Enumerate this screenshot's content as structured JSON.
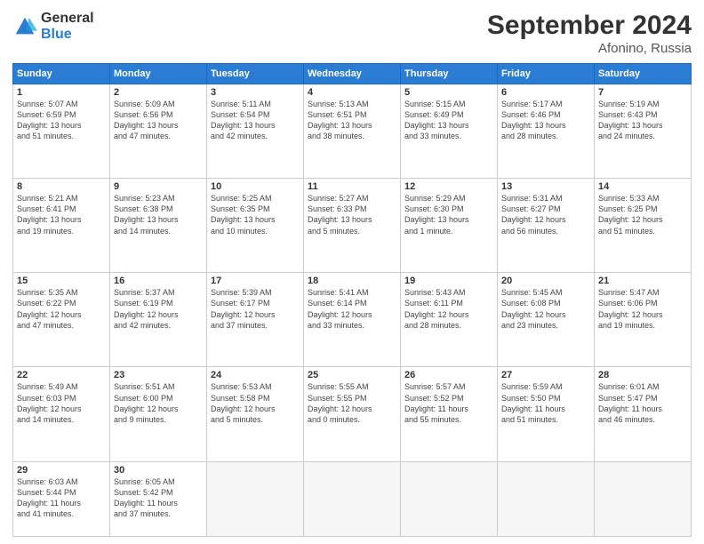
{
  "header": {
    "logo_general": "General",
    "logo_blue": "Blue",
    "title": "September 2024",
    "location": "Afonino, Russia"
  },
  "weekdays": [
    "Sunday",
    "Monday",
    "Tuesday",
    "Wednesday",
    "Thursday",
    "Friday",
    "Saturday"
  ],
  "weeks": [
    [
      {
        "day": "1",
        "info": "Sunrise: 5:07 AM\nSunset: 6:59 PM\nDaylight: 13 hours\nand 51 minutes."
      },
      {
        "day": "2",
        "info": "Sunrise: 5:09 AM\nSunset: 6:56 PM\nDaylight: 13 hours\nand 47 minutes."
      },
      {
        "day": "3",
        "info": "Sunrise: 5:11 AM\nSunset: 6:54 PM\nDaylight: 13 hours\nand 42 minutes."
      },
      {
        "day": "4",
        "info": "Sunrise: 5:13 AM\nSunset: 6:51 PM\nDaylight: 13 hours\nand 38 minutes."
      },
      {
        "day": "5",
        "info": "Sunrise: 5:15 AM\nSunset: 6:49 PM\nDaylight: 13 hours\nand 33 minutes."
      },
      {
        "day": "6",
        "info": "Sunrise: 5:17 AM\nSunset: 6:46 PM\nDaylight: 13 hours\nand 28 minutes."
      },
      {
        "day": "7",
        "info": "Sunrise: 5:19 AM\nSunset: 6:43 PM\nDaylight: 13 hours\nand 24 minutes."
      }
    ],
    [
      {
        "day": "8",
        "info": "Sunrise: 5:21 AM\nSunset: 6:41 PM\nDaylight: 13 hours\nand 19 minutes."
      },
      {
        "day": "9",
        "info": "Sunrise: 5:23 AM\nSunset: 6:38 PM\nDaylight: 13 hours\nand 14 minutes."
      },
      {
        "day": "10",
        "info": "Sunrise: 5:25 AM\nSunset: 6:35 PM\nDaylight: 13 hours\nand 10 minutes."
      },
      {
        "day": "11",
        "info": "Sunrise: 5:27 AM\nSunset: 6:33 PM\nDaylight: 13 hours\nand 5 minutes."
      },
      {
        "day": "12",
        "info": "Sunrise: 5:29 AM\nSunset: 6:30 PM\nDaylight: 13 hours\nand 1 minute."
      },
      {
        "day": "13",
        "info": "Sunrise: 5:31 AM\nSunset: 6:27 PM\nDaylight: 12 hours\nand 56 minutes."
      },
      {
        "day": "14",
        "info": "Sunrise: 5:33 AM\nSunset: 6:25 PM\nDaylight: 12 hours\nand 51 minutes."
      }
    ],
    [
      {
        "day": "15",
        "info": "Sunrise: 5:35 AM\nSunset: 6:22 PM\nDaylight: 12 hours\nand 47 minutes."
      },
      {
        "day": "16",
        "info": "Sunrise: 5:37 AM\nSunset: 6:19 PM\nDaylight: 12 hours\nand 42 minutes."
      },
      {
        "day": "17",
        "info": "Sunrise: 5:39 AM\nSunset: 6:17 PM\nDaylight: 12 hours\nand 37 minutes."
      },
      {
        "day": "18",
        "info": "Sunrise: 5:41 AM\nSunset: 6:14 PM\nDaylight: 12 hours\nand 33 minutes."
      },
      {
        "day": "19",
        "info": "Sunrise: 5:43 AM\nSunset: 6:11 PM\nDaylight: 12 hours\nand 28 minutes."
      },
      {
        "day": "20",
        "info": "Sunrise: 5:45 AM\nSunset: 6:08 PM\nDaylight: 12 hours\nand 23 minutes."
      },
      {
        "day": "21",
        "info": "Sunrise: 5:47 AM\nSunset: 6:06 PM\nDaylight: 12 hours\nand 19 minutes."
      }
    ],
    [
      {
        "day": "22",
        "info": "Sunrise: 5:49 AM\nSunset: 6:03 PM\nDaylight: 12 hours\nand 14 minutes."
      },
      {
        "day": "23",
        "info": "Sunrise: 5:51 AM\nSunset: 6:00 PM\nDaylight: 12 hours\nand 9 minutes."
      },
      {
        "day": "24",
        "info": "Sunrise: 5:53 AM\nSunset: 5:58 PM\nDaylight: 12 hours\nand 5 minutes."
      },
      {
        "day": "25",
        "info": "Sunrise: 5:55 AM\nSunset: 5:55 PM\nDaylight: 12 hours\nand 0 minutes."
      },
      {
        "day": "26",
        "info": "Sunrise: 5:57 AM\nSunset: 5:52 PM\nDaylight: 11 hours\nand 55 minutes."
      },
      {
        "day": "27",
        "info": "Sunrise: 5:59 AM\nSunset: 5:50 PM\nDaylight: 11 hours\nand 51 minutes."
      },
      {
        "day": "28",
        "info": "Sunrise: 6:01 AM\nSunset: 5:47 PM\nDaylight: 11 hours\nand 46 minutes."
      }
    ],
    [
      {
        "day": "29",
        "info": "Sunrise: 6:03 AM\nSunset: 5:44 PM\nDaylight: 11 hours\nand 41 minutes."
      },
      {
        "day": "30",
        "info": "Sunrise: 6:05 AM\nSunset: 5:42 PM\nDaylight: 11 hours\nand 37 minutes."
      },
      {
        "day": "",
        "info": ""
      },
      {
        "day": "",
        "info": ""
      },
      {
        "day": "",
        "info": ""
      },
      {
        "day": "",
        "info": ""
      },
      {
        "day": "",
        "info": ""
      }
    ]
  ]
}
